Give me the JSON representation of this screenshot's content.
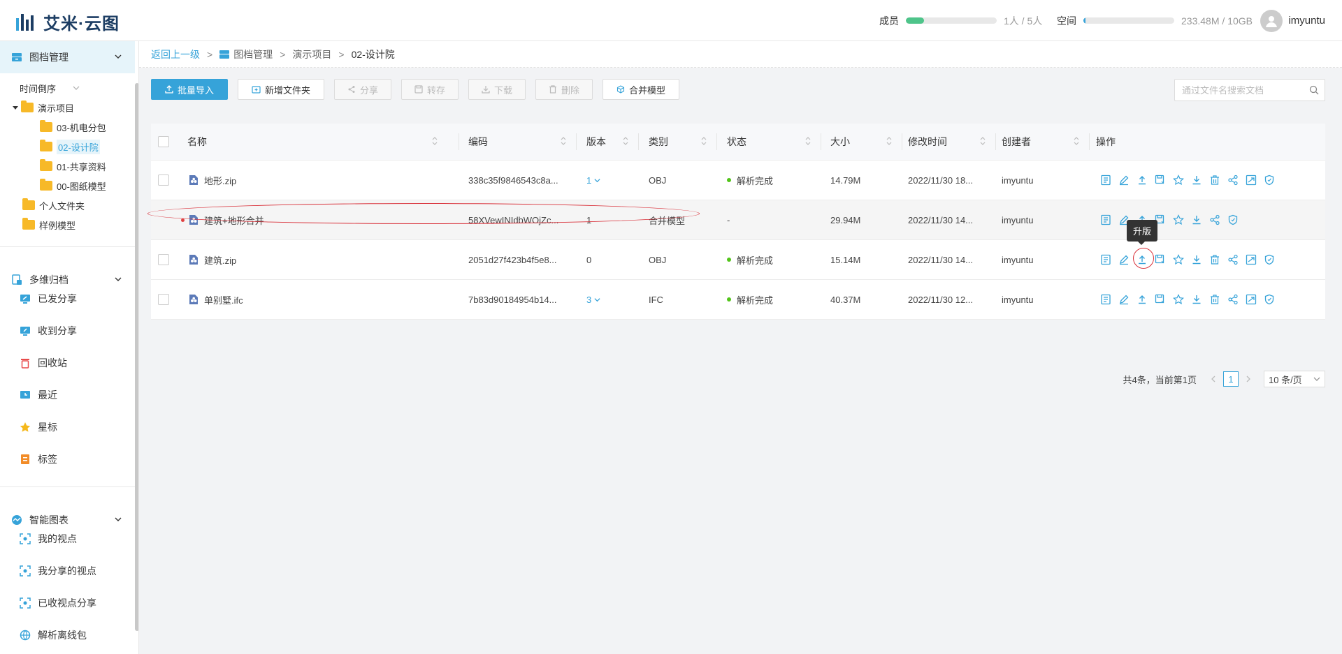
{
  "app": {
    "name": "艾米·云图"
  },
  "header": {
    "members": {
      "label": "成员",
      "value": "1人 / 5人",
      "fraction": 0.2,
      "color": "#4ec48a"
    },
    "space": {
      "label": "空间",
      "value": "233.48M / 10GB",
      "fraction": 0.023,
      "color": "#36a3d9"
    },
    "user": "imyuntu"
  },
  "sidebar": {
    "section1": {
      "title": "图档管理"
    },
    "sort": "时间倒序",
    "tree": [
      {
        "label": "演示项目"
      },
      {
        "label": "03-机电分包"
      },
      {
        "label": "02-设计院"
      },
      {
        "label": "01-共享资料"
      },
      {
        "label": "00-图纸模型"
      },
      {
        "label": "个人文件夹"
      },
      {
        "label": "样例模型"
      }
    ],
    "section2": {
      "title": "多维归档"
    },
    "archive": [
      "已发分享",
      "收到分享",
      "回收站",
      "最近",
      "星标",
      "标签"
    ],
    "section3": {
      "title": "智能图表"
    },
    "charts": [
      "我的视点",
      "我分享的视点",
      "已收视点分享",
      "解析离线包"
    ]
  },
  "breadcrumb": {
    "back": "返回上一级",
    "root": "图档管理",
    "level1": "演示项目",
    "current": "02-设计院",
    "sep": ">"
  },
  "toolbar": {
    "import": "批量导入",
    "new_folder": "新增文件夹",
    "share": "分享",
    "transfer": "转存",
    "download": "下载",
    "delete": "删除",
    "merge": "合并模型",
    "search_placeholder": "通过文件名搜索文档"
  },
  "table": {
    "headers": {
      "name": "名称",
      "code": "编码",
      "version": "版本",
      "type": "类别",
      "status": "状态",
      "size": "大小",
      "modified": "修改时间",
      "creator": "创建者",
      "ops": "操作"
    },
    "rows": [
      {
        "name": "地形.zip",
        "code": "338c35f9846543c8a...",
        "version": "1",
        "type": "OBJ",
        "status": "解析完成",
        "size": "14.79M",
        "modified": "2022/11/30 18...",
        "creator": "imyuntu"
      },
      {
        "name": "建筑+地形合并",
        "code": "58XVewINIdbWOjZc...",
        "version": "1",
        "type": "合并模型",
        "status": "-",
        "size": "29.94M",
        "modified": "2022/11/30 14...",
        "creator": "imyuntu"
      },
      {
        "name": "建筑.zip",
        "code": "2051d27f423b4f5e8...",
        "version": "0",
        "type": "OBJ",
        "status": "解析完成",
        "size": "15.14M",
        "modified": "2022/11/30 14...",
        "creator": "imyuntu"
      },
      {
        "name": "单别墅.ifc",
        "code": "7b83d90184954b14...",
        "version": "3",
        "type": "IFC",
        "status": "解析完成",
        "size": "40.37M",
        "modified": "2022/11/30 12...",
        "creator": "imyuntu"
      }
    ]
  },
  "tooltip": "升版",
  "pagination": {
    "summary": "共4条，当前第1页",
    "page": "1",
    "size": "10 条/页"
  }
}
